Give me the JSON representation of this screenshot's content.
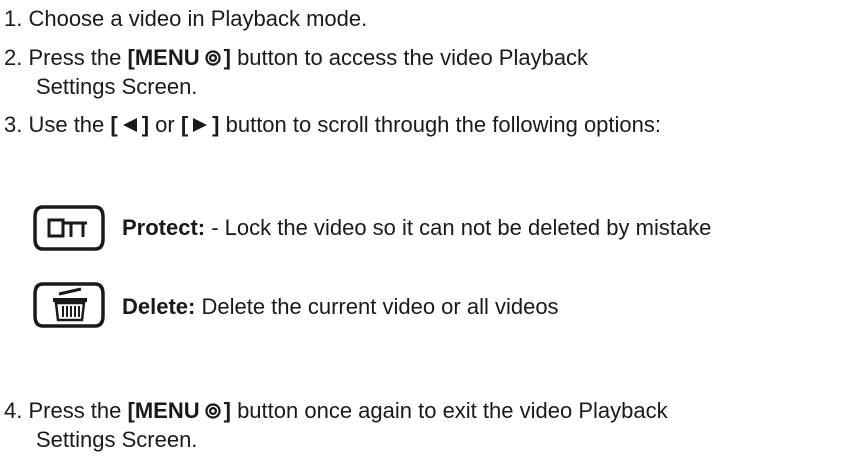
{
  "steps": {
    "s1": {
      "text": "1. Choose a video in Playback mode."
    },
    "s2": {
      "pre": "2. Press the ",
      "bold_a": "[MENU",
      "bold_b": "]",
      "post": " button to access the video Playback",
      "cont": "Settings Screen."
    },
    "s3": {
      "pre": "3. Use the ",
      "b1a": "[",
      "b1b": "]",
      "mid": " or ",
      "b2a": "[",
      "b2b": "]",
      "post": " button to scroll through the following options:"
    },
    "s4": {
      "pre": "4. Press the ",
      "bold_a": "[MENU",
      "bold_b": "]",
      "post": " button once again to exit the video Playback",
      "cont": "Settings Screen."
    }
  },
  "options": [
    {
      "title": "Protect:",
      "desc": " - Lock the video so it can not be deleted by mistake",
      "icon": "protect-icon"
    },
    {
      "title": "Delete:",
      "desc": " Delete the current video or all videos",
      "icon": "trash-icon"
    }
  ]
}
